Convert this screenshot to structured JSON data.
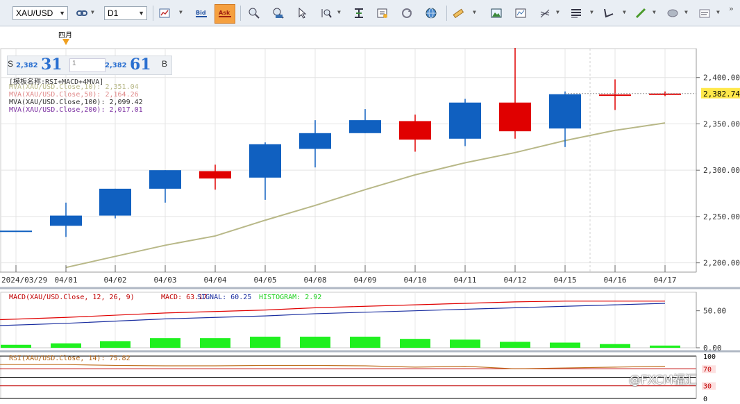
{
  "toolbar": {
    "symbol": "XAU/USD",
    "timeframe": "D1",
    "buttons": [
      "chart-type",
      "bid",
      "ask",
      "zoom-in",
      "zoom-out",
      "pointer",
      "zoom-fit",
      "crosshair",
      "properties",
      "refresh",
      "globe",
      "ruler",
      "image",
      "template",
      "fibonacci",
      "lines",
      "trend-tool",
      "pen",
      "ellipse",
      "text"
    ]
  },
  "month_label": "四月",
  "price_box": {
    "s_label": "S",
    "sell_small": "2,382",
    "sell_big": "31",
    "qty": "1",
    "buy_small": "2,382",
    "buy_big": "61",
    "b_label": "B"
  },
  "legend": {
    "template": "[模板名称:RSI+MACD+4MVA]",
    "lines": [
      {
        "text": "MVA(XAU/USD.Close,10): 2,351.04",
        "color": "#b8b888"
      },
      {
        "text": "MVA(XAU/USD.Close,50): 2,164.26",
        "color": "#e08a8a"
      },
      {
        "text": "MVA(XAU/USD.Close,100): 2,099.42",
        "color": "#333333"
      },
      {
        "text": "MVA(XAU/USD.Close,200): 2,017.01",
        "color": "#7a2ea0"
      }
    ]
  },
  "chart_data": {
    "type": "candlestick",
    "dates": [
      "2024/03/29",
      "04/01",
      "04/02",
      "04/03",
      "04/04",
      "04/05",
      "04/08",
      "04/09",
      "04/10",
      "04/11",
      "04/12",
      "04/15",
      "04/16",
      "04/17"
    ],
    "highlight_date": "2024/04/16",
    "candles": [
      {
        "o": 2234,
        "h": 2234,
        "l": 2234,
        "c": 2234
      },
      {
        "o": 2240,
        "h": 2265,
        "l": 2228,
        "c": 2251
      },
      {
        "o": 2251,
        "h": 2280,
        "l": 2248,
        "c": 2280
      },
      {
        "o": 2280,
        "h": 2300,
        "l": 2265,
        "c": 2300
      },
      {
        "o": 2299,
        "h": 2306,
        "l": 2279,
        "c": 2291
      },
      {
        "o": 2292,
        "h": 2330,
        "l": 2268,
        "c": 2328
      },
      {
        "o": 2323,
        "h": 2354,
        "l": 2303,
        "c": 2340
      },
      {
        "o": 2340,
        "h": 2366,
        "l": 2340,
        "c": 2354
      },
      {
        "o": 2353,
        "h": 2360,
        "l": 2320,
        "c": 2333
      },
      {
        "o": 2334,
        "h": 2377,
        "l": 2326,
        "c": 2373
      },
      {
        "o": 2373,
        "h": 2432,
        "l": 2334,
        "c": 2342
      },
      {
        "o": 2345,
        "h": 2385,
        "l": 2325,
        "c": 2382
      },
      {
        "o": 2383,
        "h": 2398,
        "l": 2365,
        "c": 2381
      },
      {
        "o": 2383,
        "h": 2385,
        "l": 2380,
        "c": 2382
      }
    ],
    "ma10": [
      null,
      2195,
      2207,
      2219,
      2229,
      2246,
      2262,
      2279,
      2295,
      2308,
      2319,
      2332,
      2343,
      2351
    ],
    "ylim": [
      2190,
      2435
    ],
    "yticks": [
      2200,
      2250,
      2300,
      2350,
      2400
    ],
    "ytick_labels": [
      "2,200.00",
      "2,250.00",
      "2,300.00",
      "2,350.00",
      "2,400.00"
    ],
    "last_price_label": "2,382.74",
    "colors": {
      "up": "#1060c0",
      "down": "#e00000",
      "ma10": "#b8b888"
    }
  },
  "macd": {
    "label": "MACD(XAU/USD.Close, 12, 26, 9)",
    "macd_text": "MACD: 63.17",
    "signal_text": "SIGNAL: 60.25",
    "hist_text": "HISTOGRAM: 2.92",
    "hist": [
      4,
      6,
      9,
      13,
      13,
      15,
      15,
      15,
      12,
      11,
      8,
      7,
      5,
      3
    ],
    "macd_line": [
      38,
      41,
      44,
      47,
      49,
      51,
      54,
      56,
      58,
      60,
      62,
      63,
      63,
      63
    ],
    "signal_line": [
      30,
      33,
      36,
      39,
      41,
      43,
      46,
      48,
      50,
      52,
      54,
      56,
      58,
      60
    ],
    "ylim": [
      0,
      75
    ],
    "yticks": [
      "50.00",
      "0.00"
    ]
  },
  "rsi": {
    "label": "RSI(XAU/USD.Close, 14): 75.82",
    "values": [
      80,
      80,
      78,
      77,
      77,
      78,
      78,
      77,
      74,
      76,
      70,
      72,
      74,
      76
    ],
    "ticks": [
      "100",
      "70",
      "30",
      "0"
    ]
  },
  "watermark": "@FXCM福汇"
}
